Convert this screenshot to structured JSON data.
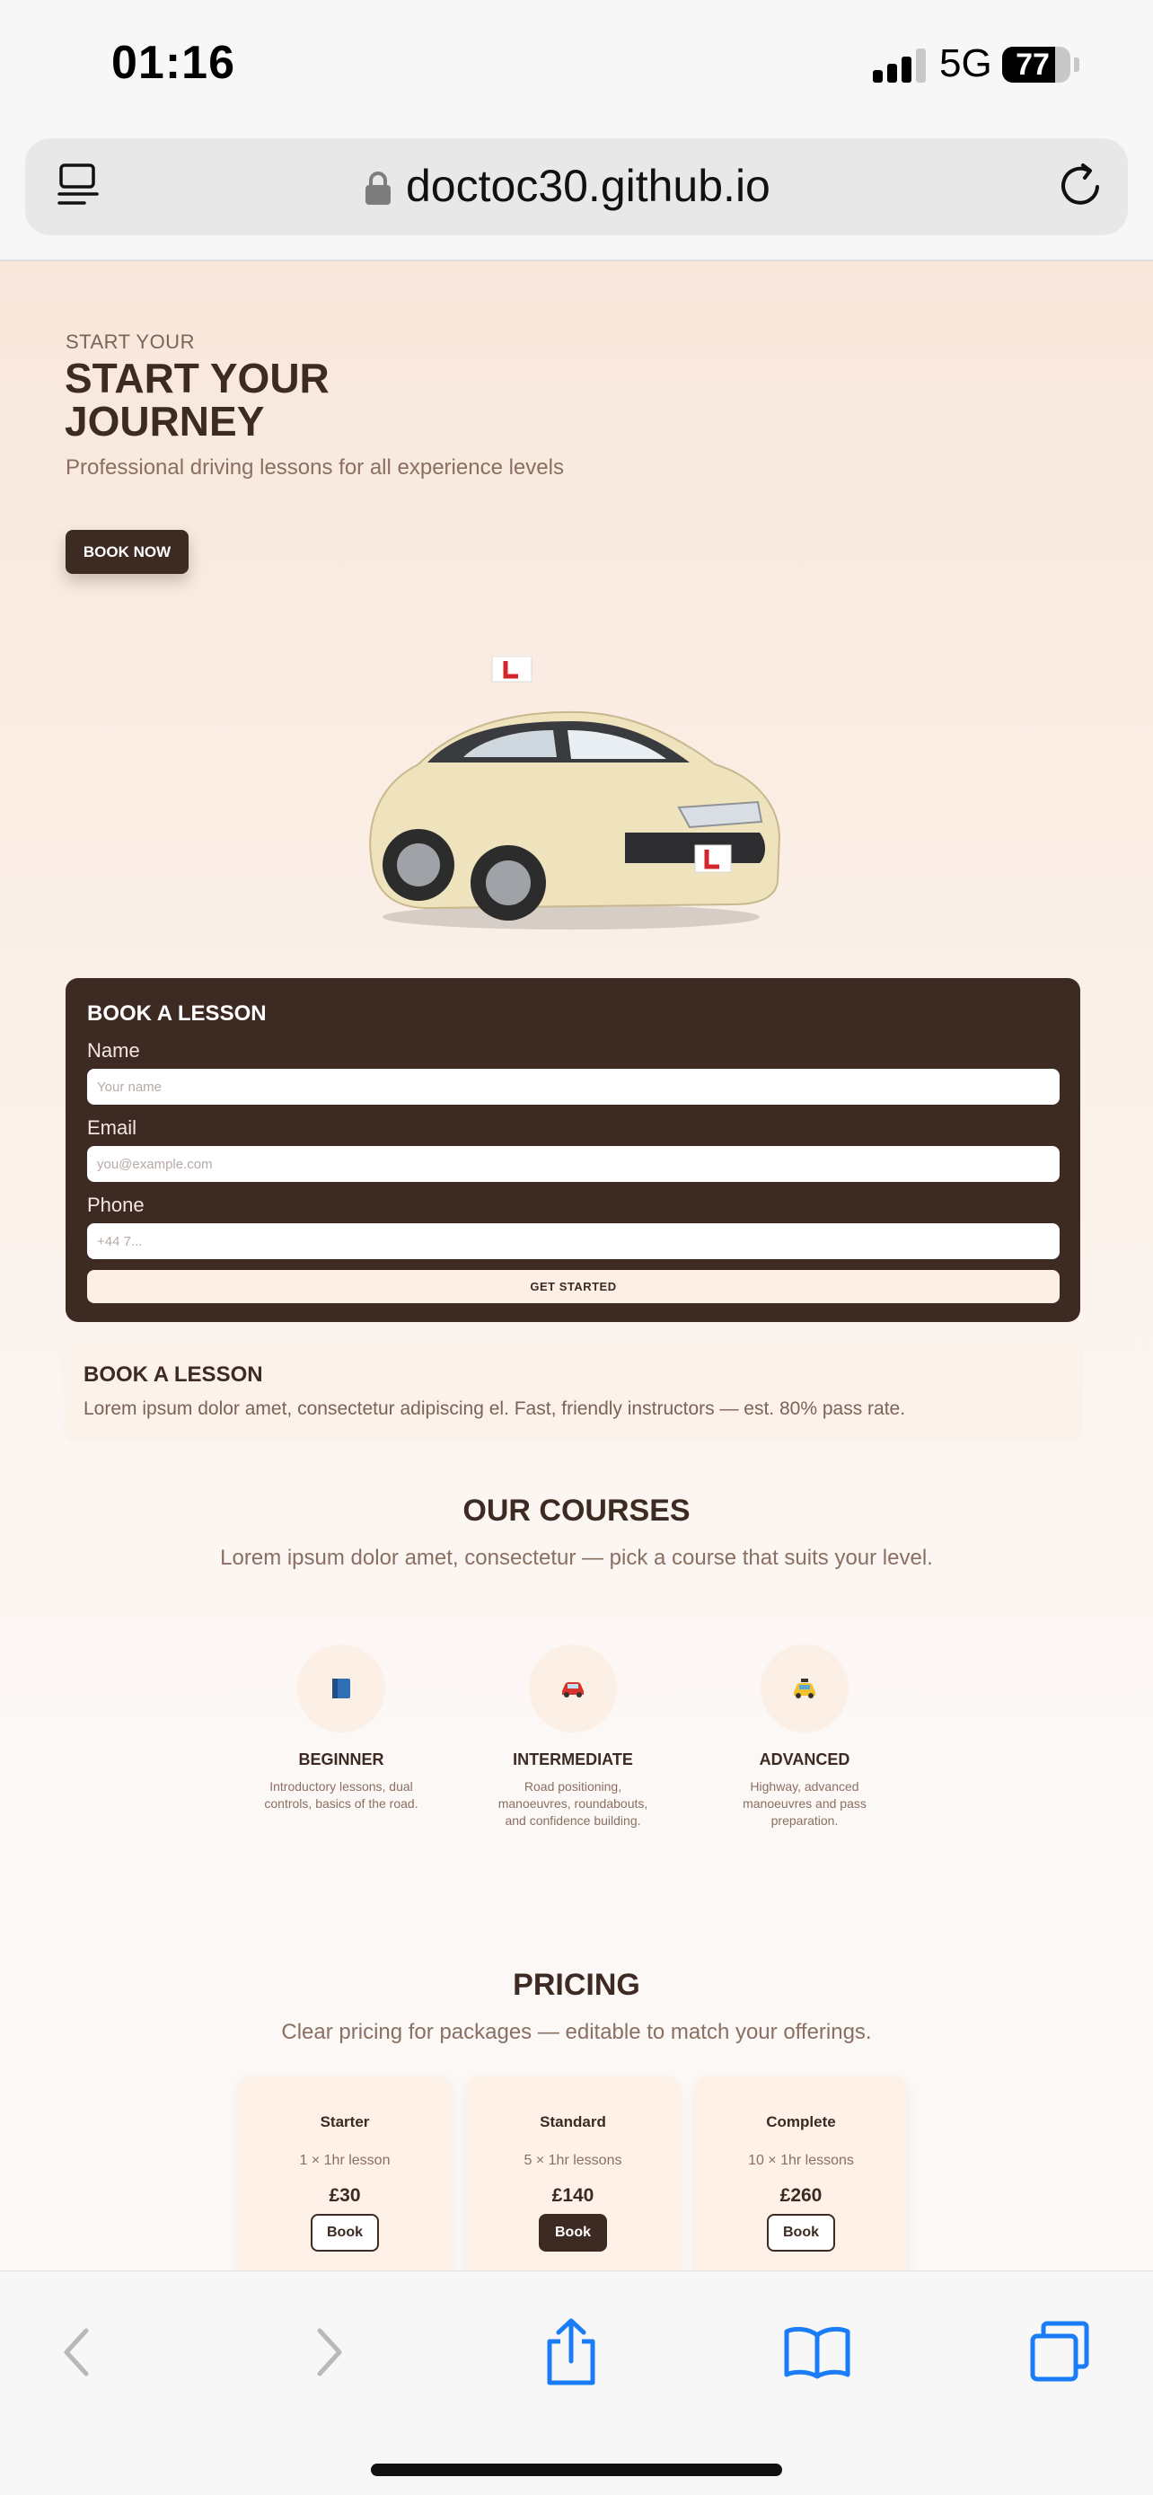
{
  "status_bar": {
    "time": "01:16",
    "network": "5G",
    "battery": "77",
    "battery_level": 0.77
  },
  "browser": {
    "url": "doctoc30.github.io"
  },
  "hero": {
    "kicker": "START YOUR",
    "title": "START YOUR JOURNEY",
    "subtitle": "Professional driving lessons for all experience levels",
    "cta": "BOOK NOW"
  },
  "booking_form": {
    "title": "BOOK A LESSON",
    "name_label": "Name",
    "name_placeholder": "Your name",
    "email_label": "Email",
    "email_placeholder": "you@example.com",
    "phone_label": "Phone",
    "phone_placeholder": "+44 7...",
    "submit": "GET STARTED"
  },
  "info_card": {
    "title": "BOOK A LESSON",
    "text": "Lorem ipsum dolor amet, consectetur adipiscing el. Fast, friendly instructors — est. 80% pass rate."
  },
  "courses": {
    "title": "OUR COURSES",
    "subtitle": "Lorem ipsum dolor amet, consectetur — pick a course that suits your level.",
    "items": [
      {
        "icon": "book-icon",
        "glyph": "📘",
        "title": "BEGINNER",
        "desc": "Introductory lessons, dual controls, basics of the road."
      },
      {
        "icon": "car-icon",
        "glyph": "🚗",
        "title": "INTERMEDIATE",
        "desc": "Road positioning, manoeuvres, roundabouts, and confidence building."
      },
      {
        "icon": "taxi-icon",
        "glyph": "🚖",
        "title": "ADVANCED",
        "desc": "Highway, advanced manoeuvres and pass preparation."
      }
    ]
  },
  "pricing": {
    "title": "PRICING",
    "subtitle": "Clear pricing for packages — editable to match your offerings.",
    "plans": [
      {
        "name": "Starter",
        "desc": "1 × 1hr lesson",
        "price": "£30",
        "button": "Book"
      },
      {
        "name": "Standard",
        "desc": "5 × 1hr lessons",
        "price": "£140",
        "button": "Book"
      },
      {
        "name": "Complete",
        "desc": "10 × 1hr lessons",
        "price": "£260",
        "button": "Book"
      }
    ]
  },
  "toolbar": {
    "icons": [
      "back-icon",
      "forward-icon",
      "share-icon",
      "bookmarks-icon",
      "tabs-icon"
    ]
  },
  "colors": {
    "brand_dark": "#3d2a22",
    "accent_soft": "#fcefe6",
    "ios_blue": "#1a7cf6"
  }
}
